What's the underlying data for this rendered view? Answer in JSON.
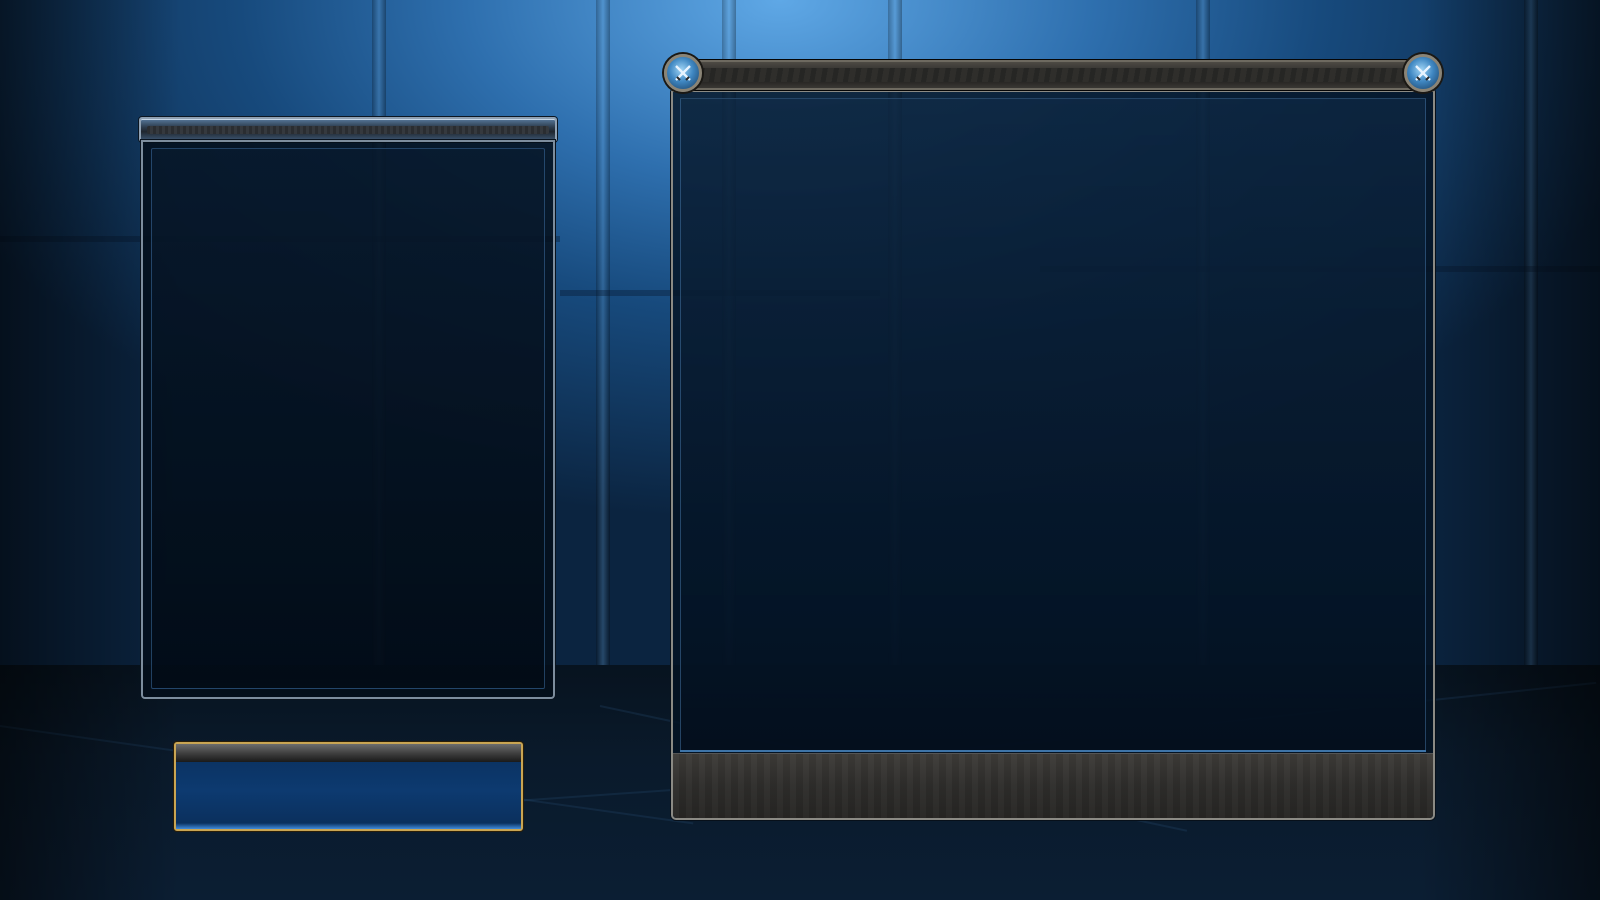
{
  "scene": {
    "background": "blue-chamber",
    "accent_colors": {
      "panel_blue": "#0d3a70",
      "gold_border": "#c9a553",
      "steel_frame": "#8b8a84"
    }
  },
  "left_panel": {
    "header_title": "",
    "content": ""
  },
  "action_button": {
    "label": ""
  },
  "right_panel": {
    "header_title": "",
    "content": "",
    "footer_text": "",
    "left_emblem_icon": "crossed-swords-icon",
    "right_emblem_icon": "crossed-swords-icon"
  }
}
